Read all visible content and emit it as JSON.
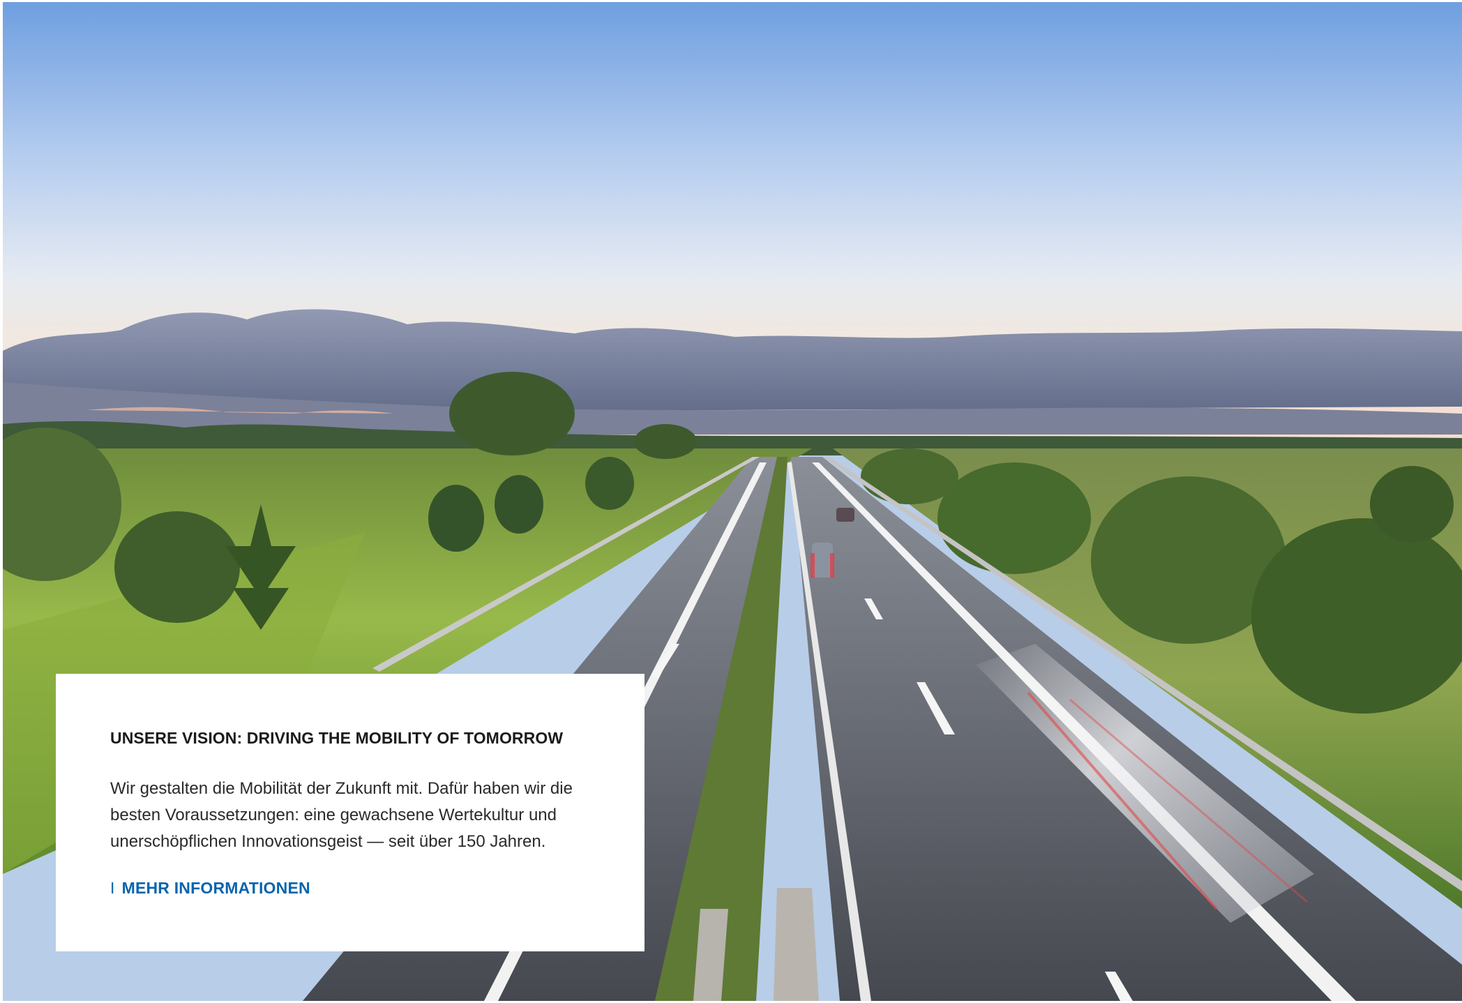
{
  "hero": {
    "image_description_icon": "highway-landscape-image"
  },
  "card": {
    "title": "UNSERE VISION: DRIVING THE MOBILITY OF TOMORROW",
    "text": "Wir gestalten die Mobilität der Zukunft mit. Dafür haben wir die besten Voraussetzungen: eine gewachsene Wertekultur und unerschöpflichen Innovationsgeist — seit über 150 Jahren.",
    "link_marker": "I",
    "link_label": "MEHR INFORMATIONEN",
    "link_color": "#0a64ad"
  }
}
